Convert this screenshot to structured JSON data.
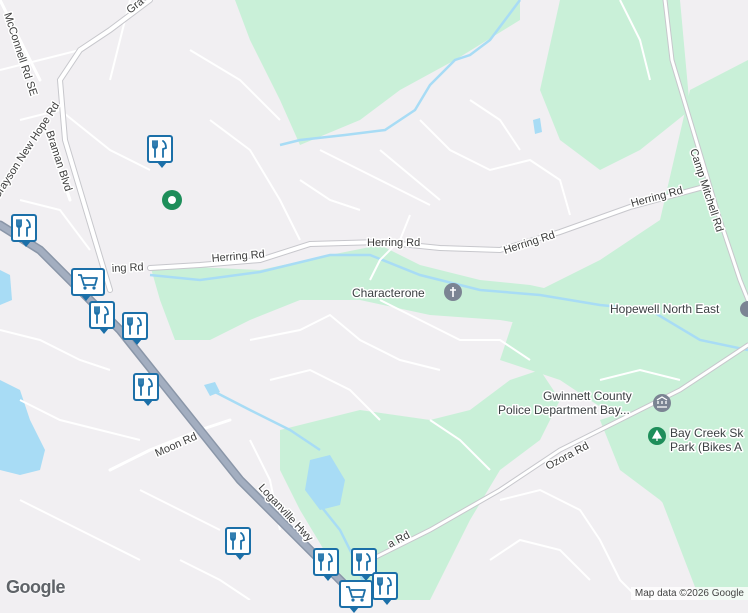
{
  "roads": {
    "grayson_new_hope_rd": "Grayson New Hope Rd",
    "mcconnell_rd_se": "McConnell Rd SE",
    "braman_blvd": "Braman Blvd",
    "herring_rd_west": "Herring Rd",
    "herring_rd_west_partial": "ing Rd",
    "herring_rd_center": "Herring Rd",
    "herring_rd_east_a": "Herring Rd",
    "herring_rd_east_b": "Herring Rd",
    "camp_mitchell_rd": "Camp Mitchell Rd",
    "moon_rd": "Moon Rd",
    "loganville_hwy": "Loganville Hwy",
    "ozora_rd": "Ozora Rd",
    "ozora_rd_partial": "a Rd",
    "top_road_partial": "Gra"
  },
  "places": {
    "characterone": "Characterone",
    "hopewell_north_east": "Hopewell North East",
    "police_line1": "Gwinnett County",
    "police_line2": "Police Department Bay...",
    "park_line1": "Bay Creek Sk",
    "park_line2": "Park (Bikes A"
  },
  "markers": [
    {
      "type": "restaurant",
      "icon": "fork-knife-icon"
    },
    {
      "type": "restaurant",
      "icon": "fork-knife-icon"
    },
    {
      "type": "grocery",
      "icon": "shopping-cart-icon"
    },
    {
      "type": "restaurant",
      "icon": "fork-knife-icon"
    },
    {
      "type": "restaurant",
      "icon": "fork-knife-icon"
    },
    {
      "type": "restaurant",
      "icon": "fork-knife-icon"
    },
    {
      "type": "restaurant",
      "icon": "fork-knife-icon"
    },
    {
      "type": "restaurant",
      "icon": "fork-knife-icon"
    },
    {
      "type": "restaurant",
      "icon": "fork-knife-icon"
    },
    {
      "type": "grocery",
      "icon": "shopping-cart-icon"
    }
  ],
  "footer": {
    "logo": "Google",
    "attribution": "Map data ©2026 Google"
  },
  "colors": {
    "background": "#f1eff2",
    "park": "#c9f0d8",
    "water": "#a8dcf5",
    "road": "#ffffff",
    "highway": "#94a3b8",
    "marker": "#1b6fa8",
    "park_icon": "#1e8e5a"
  }
}
